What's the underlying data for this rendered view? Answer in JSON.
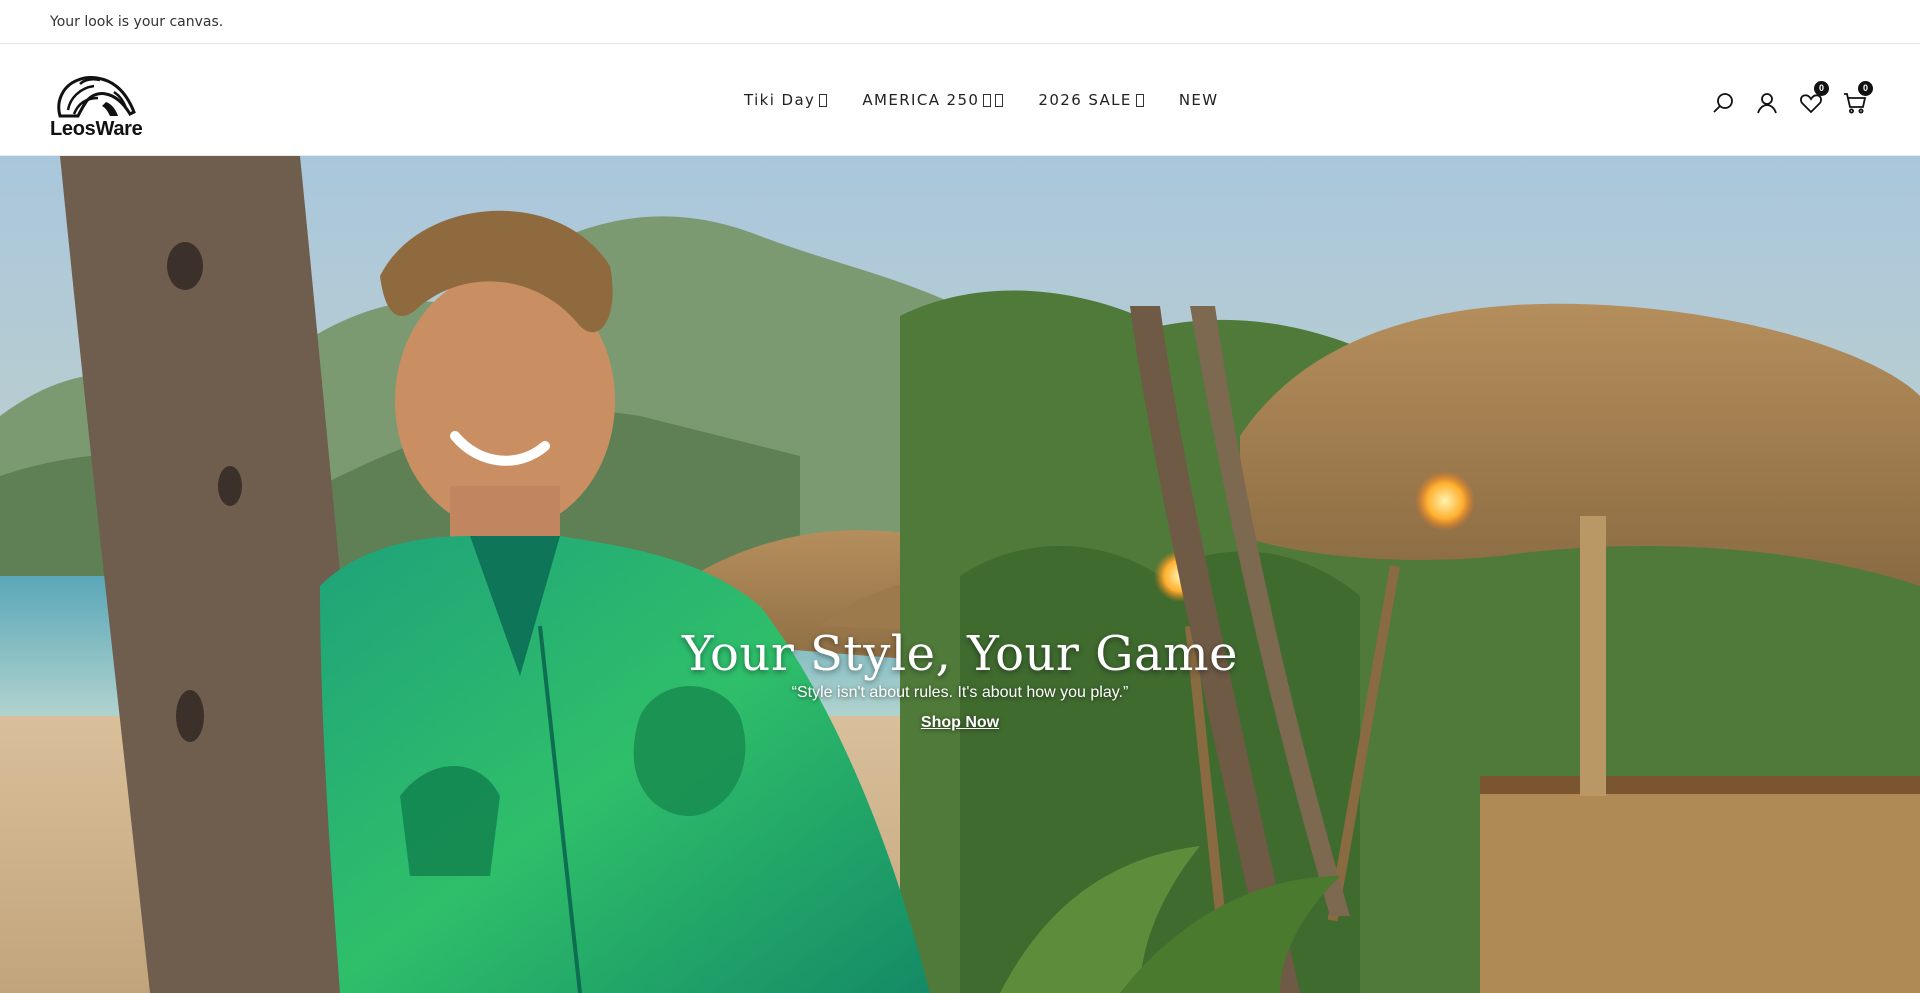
{
  "announcement": {
    "text": "Your look is your canvas."
  },
  "header": {
    "logo_text": "LeosWare",
    "nav": [
      {
        "label": "Tiki Day"
      },
      {
        "label": "AMERICA 250"
      },
      {
        "label": "2026 SALE"
      },
      {
        "label": "NEW"
      }
    ],
    "icons": {
      "search": "search-icon",
      "account": "user-icon",
      "wishlist": "heart-icon",
      "cart": "cart-icon"
    },
    "wishlist_count": "0",
    "cart_count": "0"
  },
  "hero": {
    "title": "Your Style, Your Game",
    "subtitle": "“Style isn't about rules. It's about how you play.”",
    "cta": "Shop Now"
  }
}
